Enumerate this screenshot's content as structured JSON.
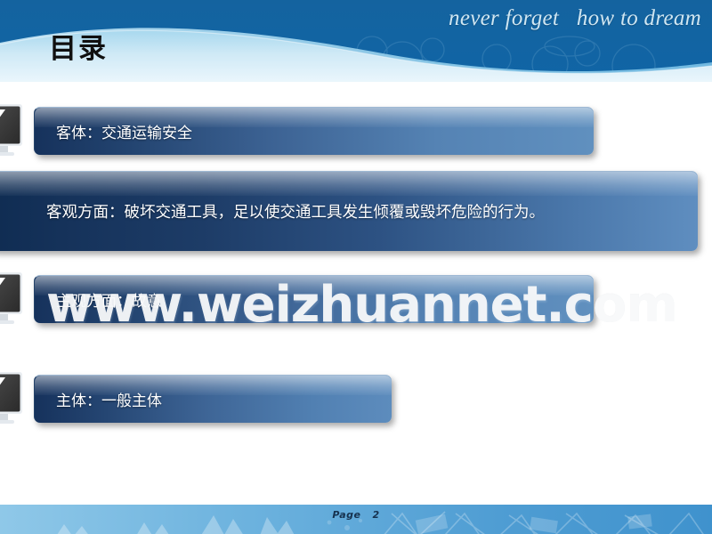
{
  "header": {
    "tagline": "never forget   how to dream",
    "title": "目录",
    "bg_color": "#1463a0",
    "wave_color": "#bfe2f2"
  },
  "content": {
    "rows": [
      {
        "badge_icon": "monitor-arrow-icon",
        "label": "客体：交通运输安全"
      },
      {
        "badge_icon": "monitor-arrow-icon",
        "label": "客观方面：破坏交通工具，足以使交通工具发生倾覆或毁坏危险的行为。"
      },
      {
        "badge_icon": "monitor-arrow-icon",
        "label": "主观方面：故意"
      },
      {
        "badge_icon": "monitor-arrow-icon",
        "label": "主体：一般主体"
      }
    ],
    "bar_color_dark": "#16325c",
    "bar_color_light": "#6090bf"
  },
  "watermark": {
    "text": "www.weizhuannet.com"
  },
  "footer": {
    "page_label": "Page   2",
    "band_color": "#4e9bd0"
  }
}
